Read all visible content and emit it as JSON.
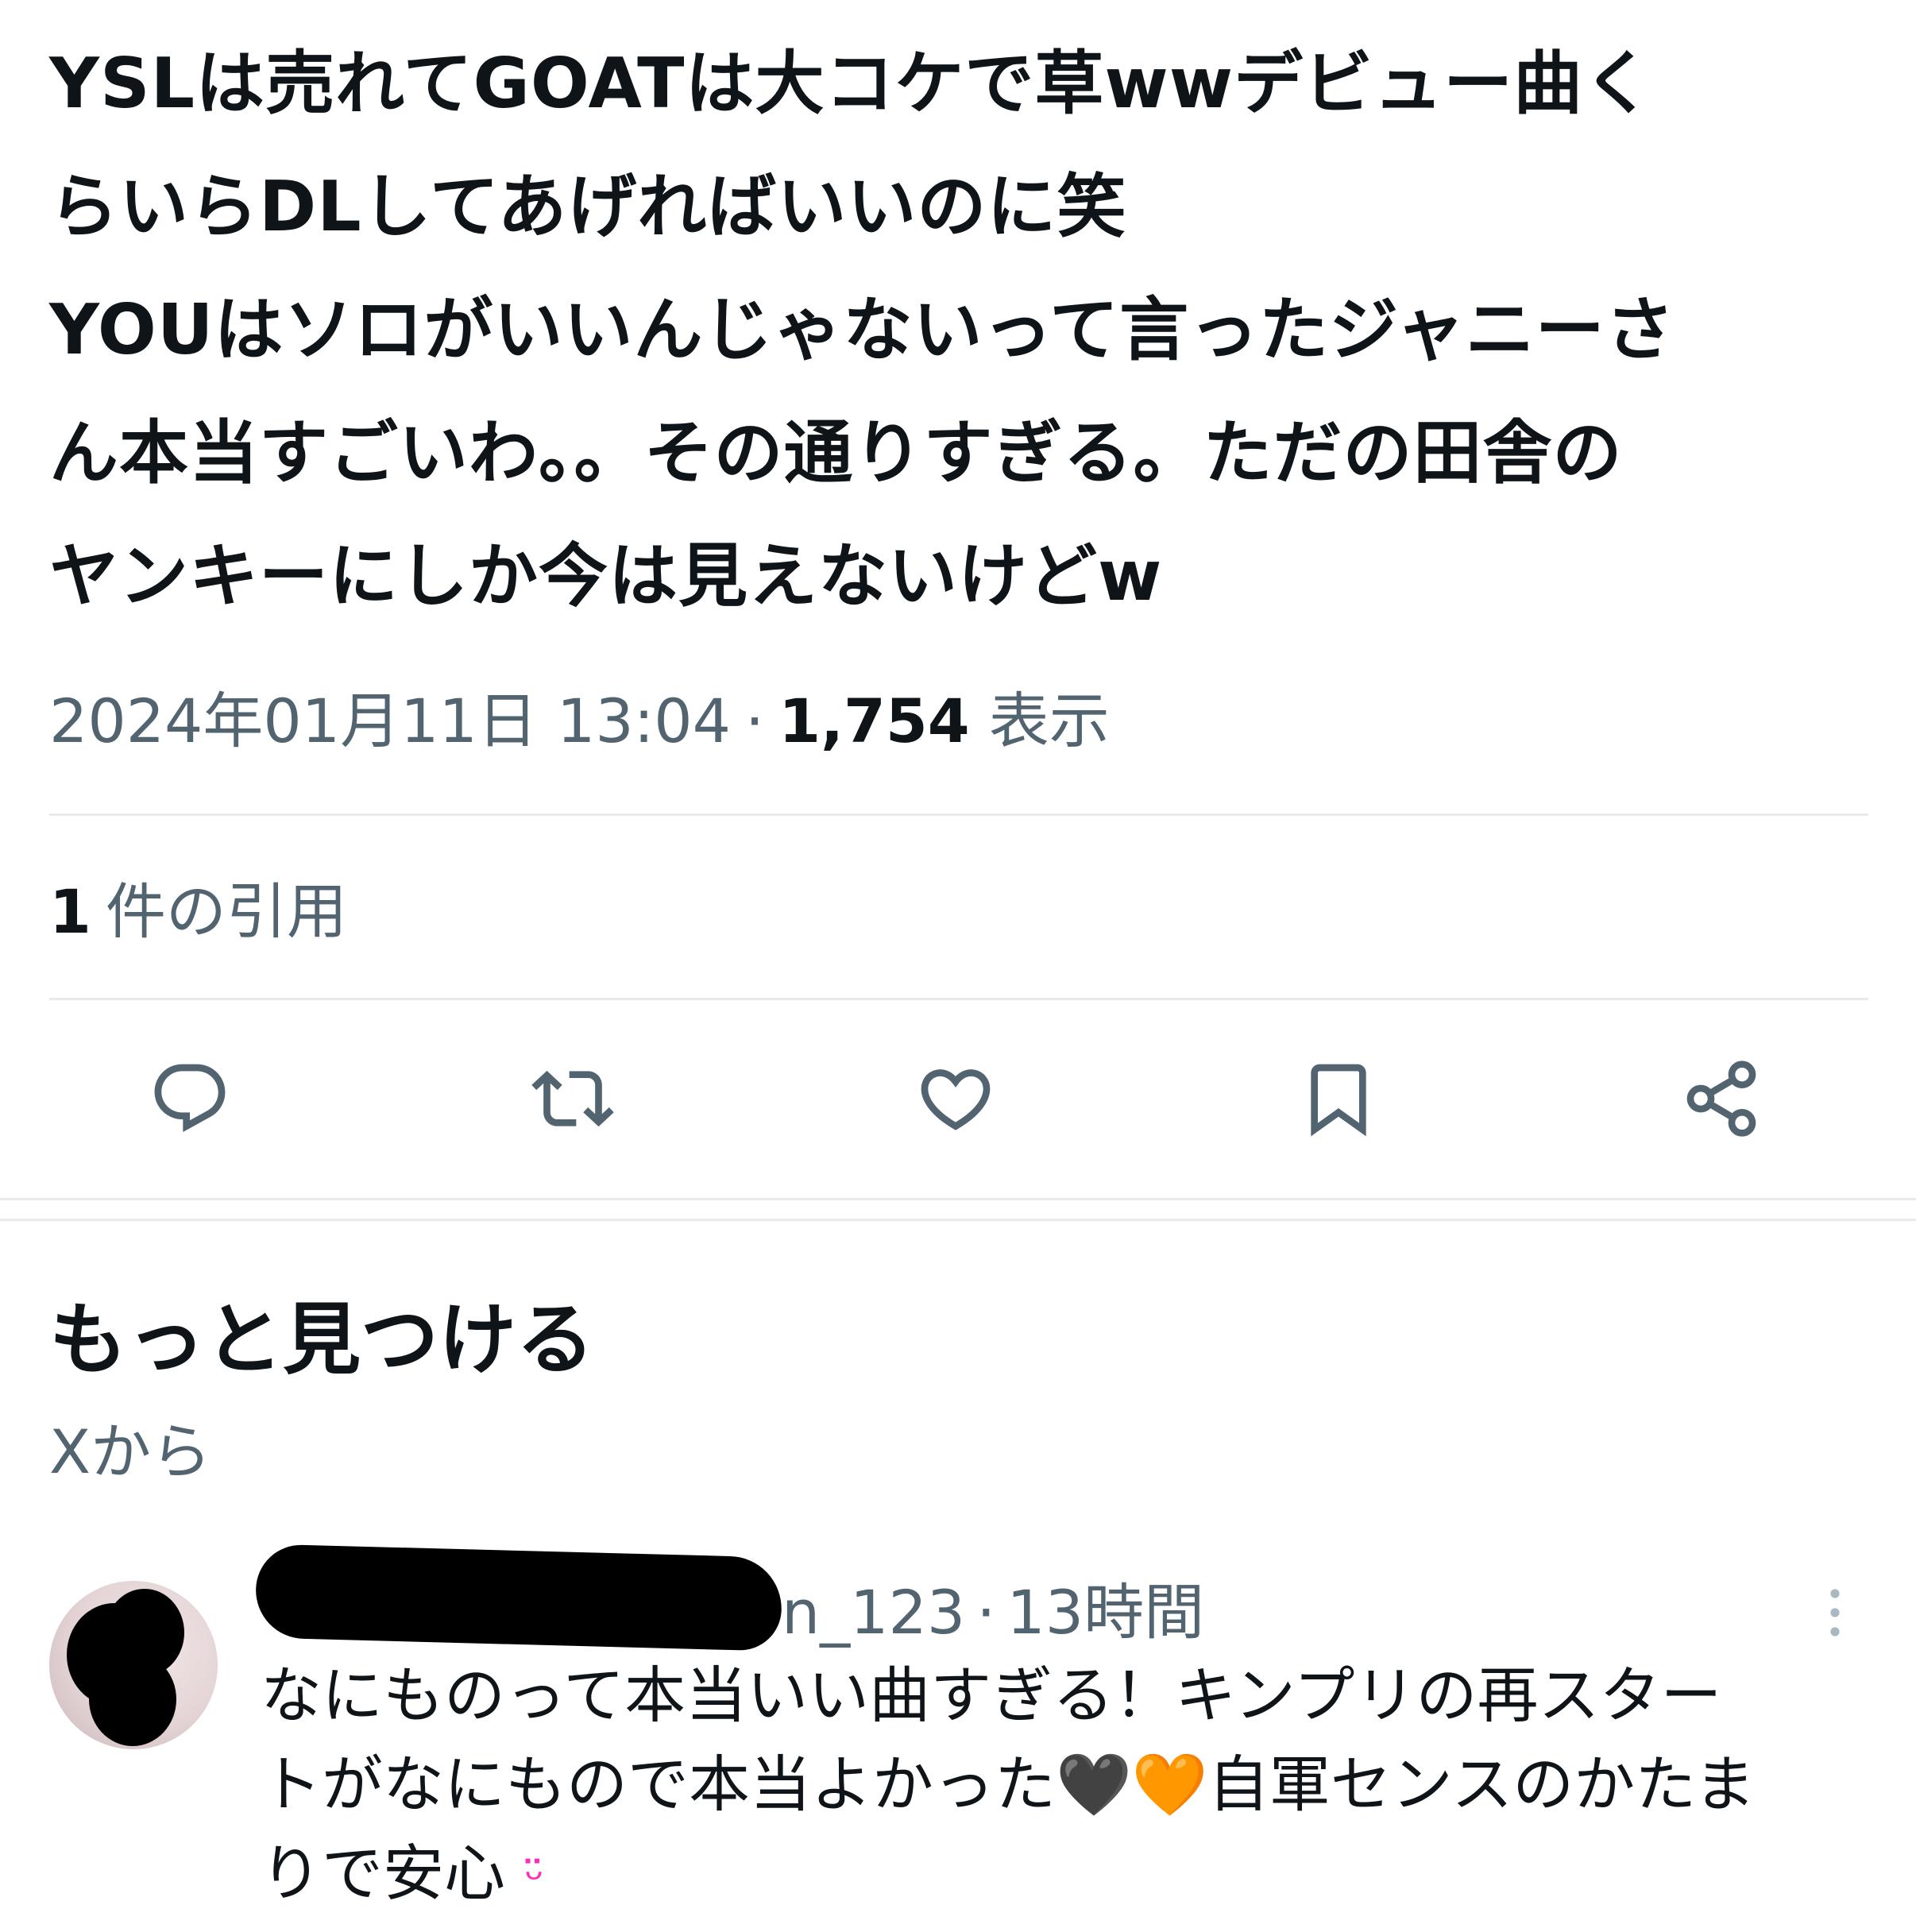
{
  "tweet": {
    "lines": [
      "YSLは売れてGOATは大コケで草wwデビュー曲く",
      "らいらDLしてあげればいいのに笑",
      "YOUはソロがいいんじゃないって言ったジャニーさ",
      "ん本当すごいわ。。その通りすぎる。ただの田舎の",
      "ヤンキーにしか今は見えないけどw"
    ],
    "timestamp": "2024年01月11日 13:04",
    "separator": "·",
    "views_count": "1,754",
    "views_label": "表示"
  },
  "quotes": {
    "count": "1",
    "label": "件の引用"
  },
  "actions": {
    "reply_icon": "reply-icon",
    "retweet_icon": "retweet-icon",
    "like_icon": "heart-icon",
    "bookmark_icon": "bookmark-icon",
    "share_icon": "share-icon"
  },
  "discover": {
    "title": "もっと見つける",
    "subtitle": "Xから"
  },
  "post": {
    "handle_suffix": "n_123",
    "separator": "·",
    "time": "13時間",
    "line1": "なにものって本当いい曲すぎる！キンプリの再スター",
    "line2_a": "トがなにもので本当よかった",
    "heart_black": "🖤",
    "heart_orange": "🧡",
    "line2_b": "自軍センスのかたま",
    "line3": "りで安心",
    "heart_pink": "ᵕ̈"
  },
  "colors": {
    "text_primary": "#0f1419",
    "text_secondary": "#536471",
    "divider": "#e6eaed",
    "icon": "#536471"
  }
}
